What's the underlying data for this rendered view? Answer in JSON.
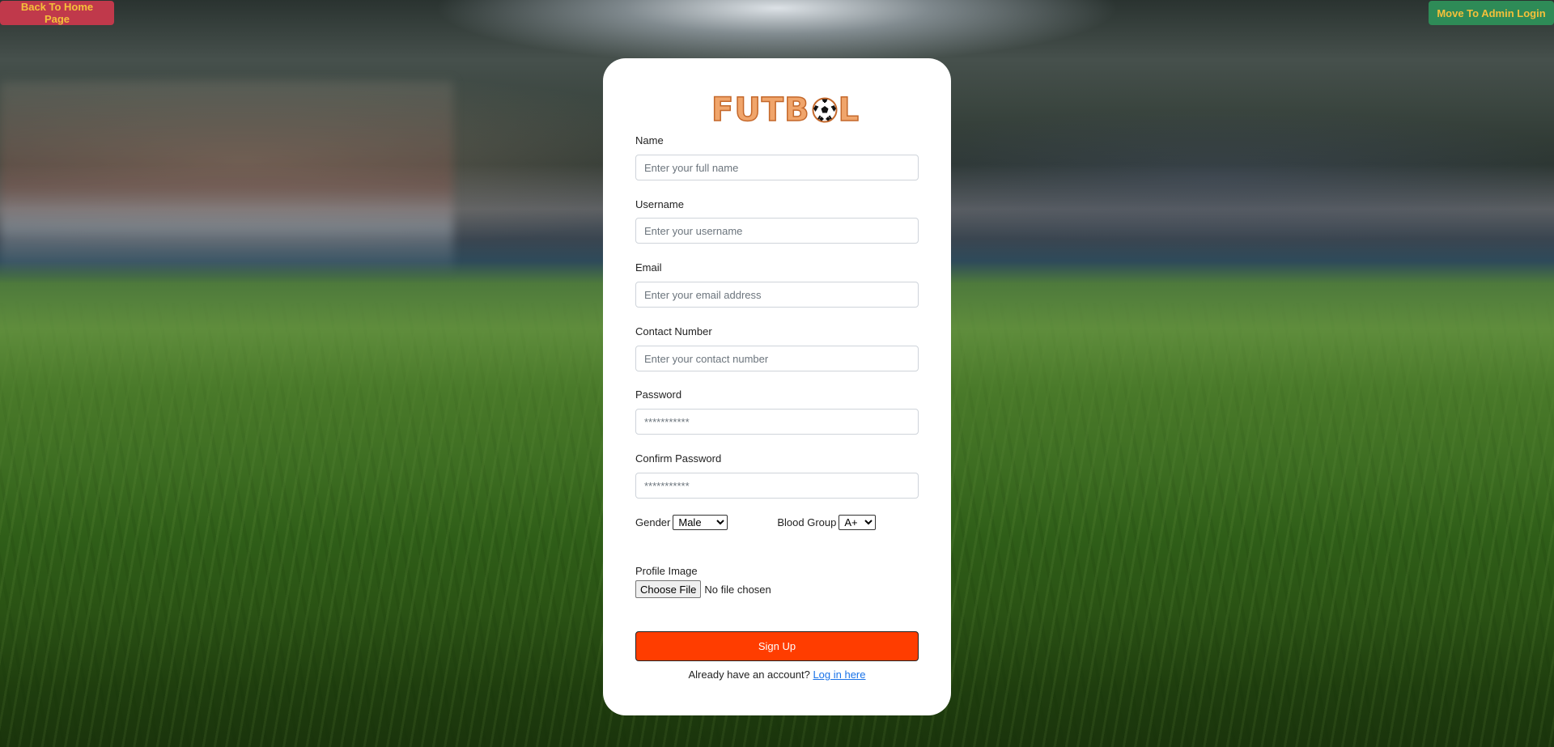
{
  "top_bar": {
    "home_label": "Back To Home Page",
    "admin_label": "Move To Admin Login"
  },
  "brand": {
    "logo_left": "FUTB",
    "logo_right": "L"
  },
  "form": {
    "name": {
      "label": "Name",
      "placeholder": "Enter your full name"
    },
    "username": {
      "label": "Username",
      "placeholder": "Enter your username"
    },
    "email": {
      "label": "Email",
      "placeholder": "Enter your email address"
    },
    "contact": {
      "label": "Contact Number",
      "placeholder": "Enter your contact number"
    },
    "password": {
      "label": "Password",
      "placeholder": "***********"
    },
    "confirm_password": {
      "label": "Confirm Password",
      "placeholder": "***********"
    },
    "gender": {
      "label": "Gender",
      "selected": "Male"
    },
    "blood_group": {
      "label": "Blood Group",
      "selected": "A+"
    },
    "profile_image": {
      "label": "Profile Image",
      "button": "Choose File",
      "status": "No file chosen"
    },
    "submit_label": "Sign Up",
    "login_prompt": "Already have an account?",
    "login_link": "Log in here"
  },
  "colors": {
    "home_button_bg": "#c0394b",
    "admin_button_bg": "#2e8b57",
    "top_button_text": "#f4c03a",
    "signup_bg": "#ff3d00",
    "logo_fill": "#f0a56b",
    "link": "#1a73e8"
  },
  "icons": {
    "logo_ball": "soccer-ball-icon",
    "select_arrow": "chevron-down-icon"
  }
}
